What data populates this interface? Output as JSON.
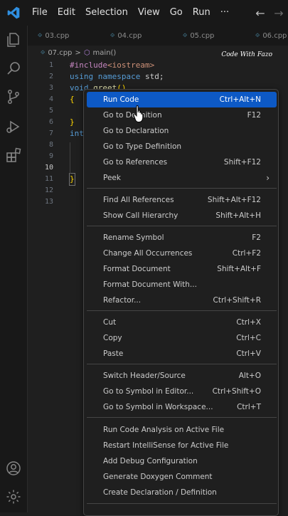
{
  "menubar": {
    "items": [
      "File",
      "Edit",
      "Selection",
      "View",
      "Go",
      "Run"
    ],
    "more": "···"
  },
  "icons": {
    "logo": "vscode-logo-icon",
    "back": "←",
    "forward": "→"
  },
  "tabs": [
    "03.cpp",
    "04.cpp",
    "05.cpp",
    "06.cpp"
  ],
  "breadcrumb": {
    "file": "07.cpp",
    "sep": ">",
    "symbol": "main()"
  },
  "watermark": "Code With Fazo",
  "line_numbers": [
    "1",
    "2",
    "3",
    "4",
    "5",
    "6",
    "7",
    "8",
    "9",
    "10",
    "11",
    "12",
    "13"
  ],
  "code": {
    "l1_pp": "#include",
    "l1_inc": "<iostream>",
    "l2_kw": "using namespace",
    "l2_pl": " std;",
    "l3_kw": "void",
    "l3_fn": " greet",
    "l3_pl": "()",
    "l4": "{",
    "l6": "}",
    "l7_kw": "int",
    "l10": "}"
  },
  "context_menu": {
    "items": [
      {
        "label": "Run Code",
        "key": "Ctrl+Alt+N"
      },
      {
        "label": "Go to Definition",
        "key": "F12"
      },
      {
        "label": "Go to Declaration",
        "key": ""
      },
      {
        "label": "Go to Type Definition",
        "key": ""
      },
      {
        "label": "Go to References",
        "key": "Shift+F12"
      },
      {
        "label": "Peek",
        "key": ""
      },
      {
        "label": "Find All References",
        "key": "Shift+Alt+F12"
      },
      {
        "label": "Show Call Hierarchy",
        "key": "Shift+Alt+H"
      },
      {
        "label": "Rename Symbol",
        "key": "F2"
      },
      {
        "label": "Change All Occurrences",
        "key": "Ctrl+F2"
      },
      {
        "label": "Format Document",
        "key": "Shift+Alt+F"
      },
      {
        "label": "Format Document With...",
        "key": ""
      },
      {
        "label": "Refactor...",
        "key": "Ctrl+Shift+R"
      },
      {
        "label": "Cut",
        "key": "Ctrl+X"
      },
      {
        "label": "Copy",
        "key": "Ctrl+C"
      },
      {
        "label": "Paste",
        "key": "Ctrl+V"
      },
      {
        "label": "Switch Header/Source",
        "key": "Alt+O"
      },
      {
        "label": "Go to Symbol in Editor...",
        "key": "Ctrl+Shift+O"
      },
      {
        "label": "Go to Symbol in Workspace...",
        "key": "Ctrl+T"
      },
      {
        "label": "Run Code Analysis on Active File",
        "key": ""
      },
      {
        "label": "Restart IntelliSense for Active File",
        "key": ""
      },
      {
        "label": "Add Debug Configuration",
        "key": ""
      },
      {
        "label": "Generate Doxygen Comment",
        "key": ""
      },
      {
        "label": "Create Declaration / Definition",
        "key": ""
      }
    ],
    "submenu_arrow": "›"
  },
  "colors": {
    "accent": "#0d59c5",
    "background": "#1f1f1f",
    "logo": "#2f8fe0"
  }
}
